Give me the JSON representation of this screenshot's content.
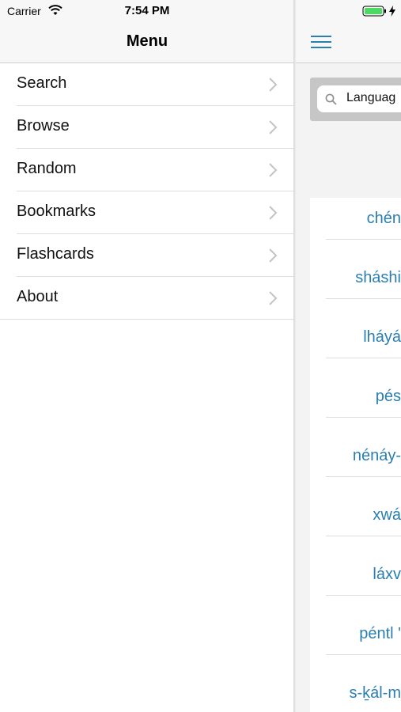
{
  "status": {
    "carrier": "Carrier",
    "time": "7:54 PM"
  },
  "menu": {
    "title": "Menu",
    "items": [
      {
        "label": "Search"
      },
      {
        "label": "Browse"
      },
      {
        "label": "Random"
      },
      {
        "label": "Bookmarks"
      },
      {
        "label": "Flashcards"
      },
      {
        "label": "About"
      }
    ]
  },
  "content": {
    "search": {
      "value": "Languag"
    },
    "results": [
      {
        "word": "chén"
      },
      {
        "word": "sháshi"
      },
      {
        "word": "lháyá"
      },
      {
        "word": "pés"
      },
      {
        "word": "nénáy-"
      },
      {
        "word": "xwá"
      },
      {
        "word": "láxv"
      },
      {
        "word": "péntl '"
      },
      {
        "word": "s-ḵál-m"
      }
    ]
  },
  "colors": {
    "link": "#2a7fb0",
    "accent": "#2a7fb0",
    "battery": "#4cd964"
  },
  "icons": {
    "wifi": "wifi-icon",
    "battery": "battery-icon",
    "hamburger": "hamburger-icon",
    "search": "search-icon",
    "chevron": "chevron-right-icon"
  }
}
